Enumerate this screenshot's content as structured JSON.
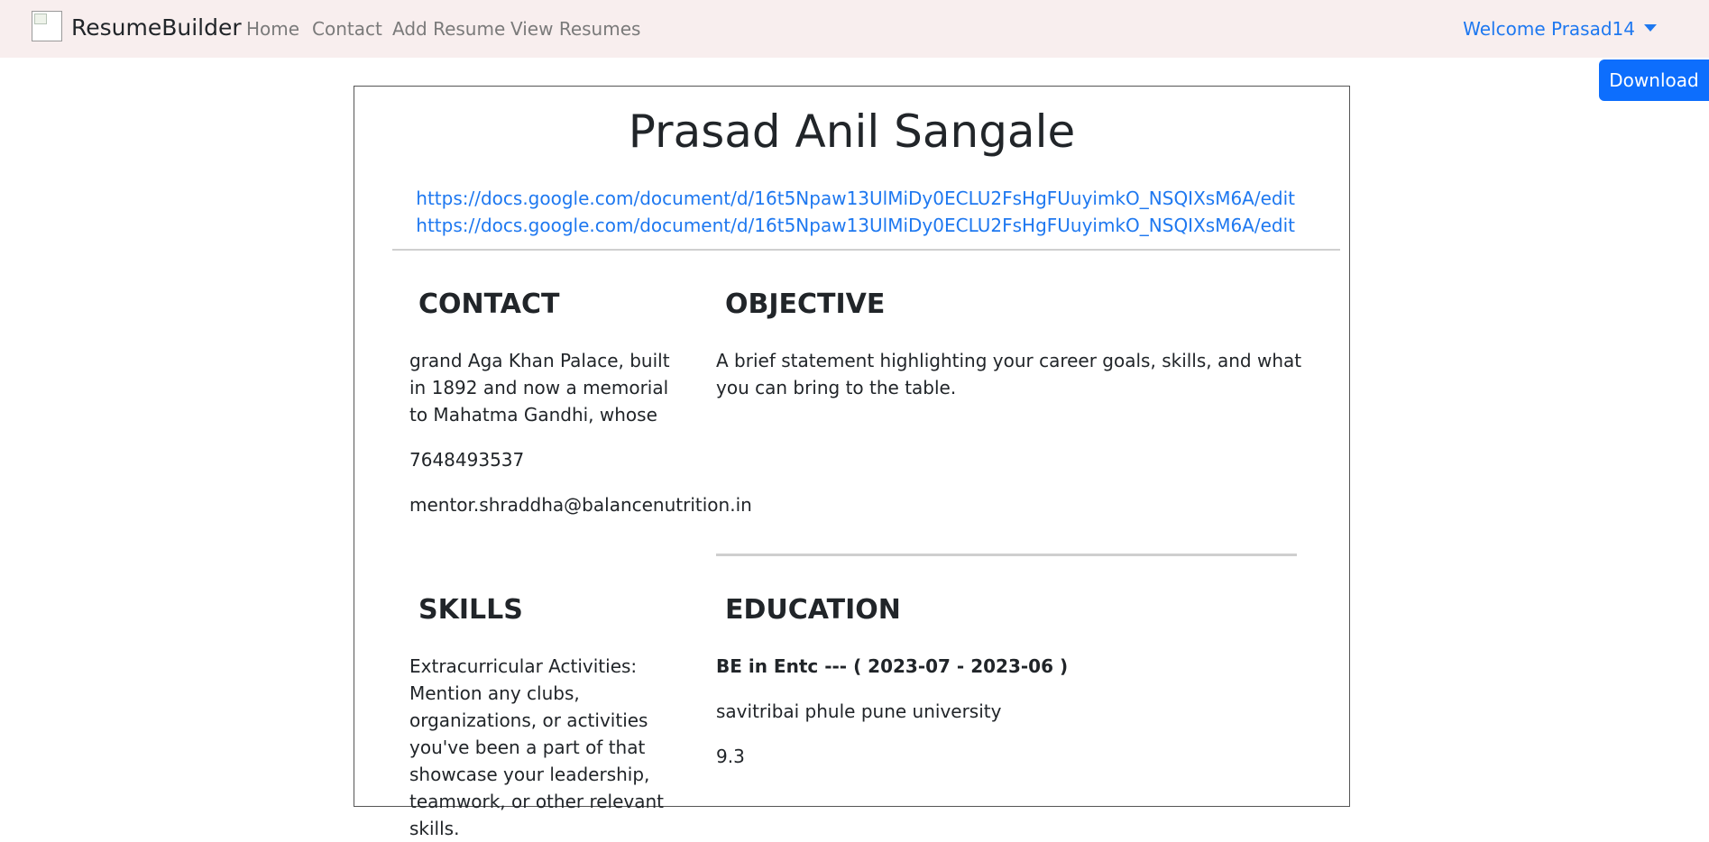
{
  "navbar": {
    "brand": "ResumeBuilder",
    "links": [
      "Home",
      "Contact",
      "Add Resume",
      "View Resumes"
    ],
    "welcome": "Welcome Prasad14"
  },
  "download_label": "Download",
  "resume": {
    "name": "Prasad Anil Sangale",
    "links": [
      "https://docs.google.com/document/d/16t5Npaw13UlMiDy0ECLU2FsHgFUuyimkO_NSQIXsM6A/edit",
      "https://docs.google.com/document/d/16t5Npaw13UlMiDy0ECLU2FsHgFUuyimkO_NSQIXsM6A/edit"
    ],
    "contact": {
      "title": "CONTACT",
      "address": "grand Aga Khan Palace, built in 1892 and now a memorial to Mahatma Gandhi, whose",
      "phone": "7648493537",
      "email": "mentor.shraddha@balancenutrition.in"
    },
    "objective": {
      "title": "OBJECTIVE",
      "text": "A brief statement highlighting your career goals, skills, and what you can bring to the table."
    },
    "skills": {
      "title": "SKILLS",
      "text": "Extracurricular Activities: Mention any clubs, organizations, or activities you've been a part of that showcase your leadership, teamwork, or other relevant skills."
    },
    "education": {
      "title": "EDUCATION",
      "degree": "BE in Entc --- ( 2023-07 - 2023-06 )",
      "university": "savitribai phule pune university",
      "score": "9.3"
    }
  }
}
